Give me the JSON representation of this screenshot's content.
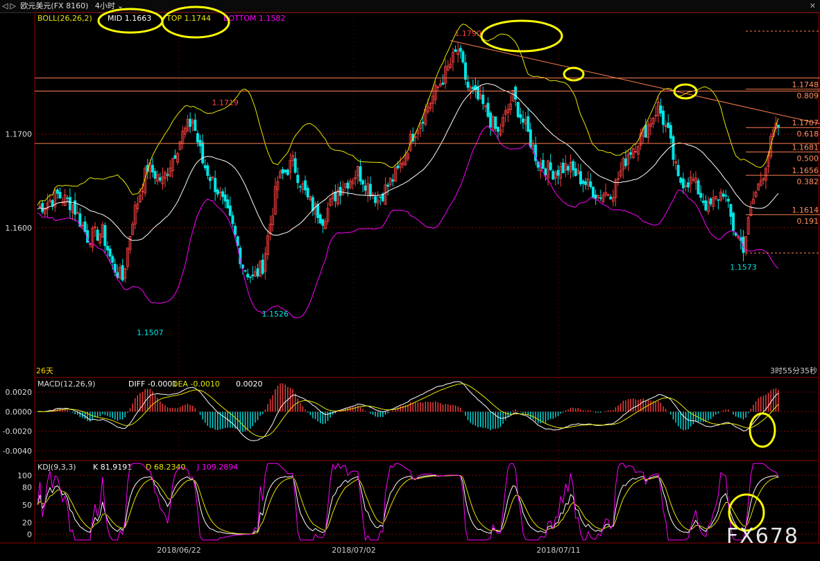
{
  "window": {
    "title": "欧元美元(FX 8160)",
    "period": "4小时",
    "icons": [
      "back-icon",
      "forward-icon",
      "chevron-down-icon",
      "close-icon"
    ]
  },
  "chart_data": {
    "type": "candlestick",
    "symbol": "欧元美元(FX 8160)",
    "period": "4小时",
    "boll": {
      "label": "BOLL(26,26,2)",
      "mid": "MID 1.1663",
      "top": "TOP 1.1744",
      "bottom": "BOTTOM 1.1582"
    },
    "macd": {
      "label": "MACD(12,26,9)",
      "diff": "DIFF -0.0001",
      "dea": "DEA -0.0010",
      "macd": "0.0020"
    },
    "kdj": {
      "label": "KDJ(9,3,3)",
      "k": "K 81.9191",
      "d": "D 68.2340",
      "j": "J 109.2894"
    },
    "price_ticks": [
      "1.1700",
      "1.1600"
    ],
    "macd_ticks": [
      "0.0020",
      "0.0000",
      "-0.0020",
      "-0.0040"
    ],
    "kdj_ticks": [
      "100",
      "80",
      "50",
      "20",
      "0"
    ],
    "x_labels": [
      "2018/06/22",
      "2018/07/02",
      "2018/07/11"
    ],
    "annotations": [
      "1.1790",
      "1.1719",
      "1.1526",
      "1.1507",
      "1.1573"
    ],
    "fib_levels": [
      {
        "price": "1.1748",
        "ratio": "0.809"
      },
      {
        "price": "1.1707",
        "ratio": "0.618"
      },
      {
        "price": "1.1681",
        "ratio": "0.500"
      },
      {
        "price": "1.1656",
        "ratio": "0.382"
      },
      {
        "price": "1.1614",
        "ratio": "0.191"
      }
    ],
    "days_label": "26天",
    "countdown": "3时55分35秒",
    "watermark": "FX678",
    "colors": {
      "up": "#ff4040",
      "down": "#00e5e5",
      "mid": "#ffffff",
      "top": "#e8e800",
      "bottom": "#ff00ff",
      "grid": "#8b0000",
      "highlight": "#ffff00"
    }
  }
}
